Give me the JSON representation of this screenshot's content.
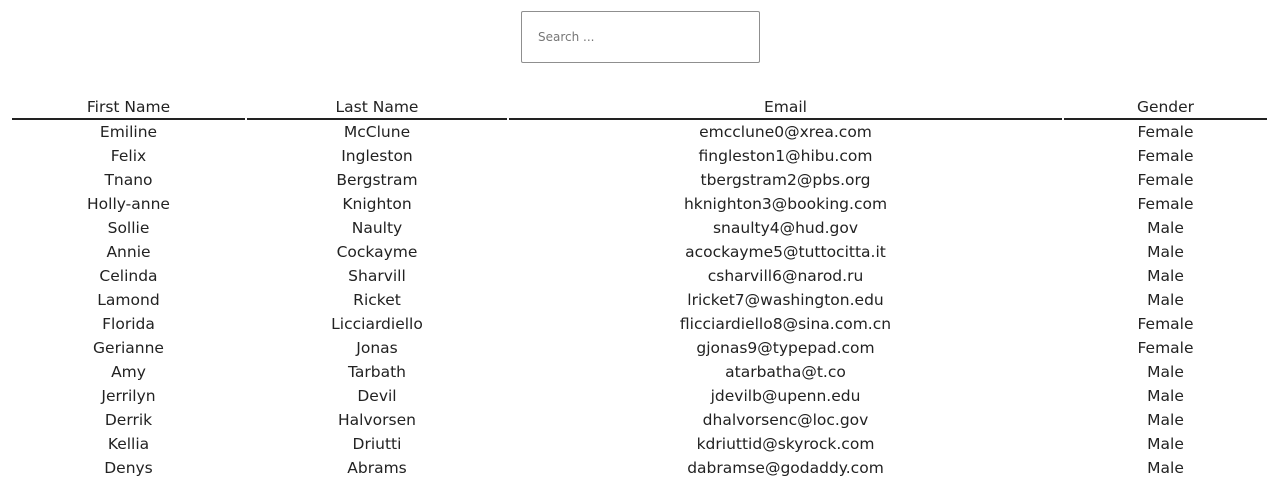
{
  "search": {
    "placeholder": "Search ..."
  },
  "table": {
    "headers": [
      "First Name",
      "Last Name",
      "Email",
      "Gender"
    ],
    "rows": [
      [
        "Emiline",
        "McClune",
        "emcclune0@xrea.com",
        "Female"
      ],
      [
        "Felix",
        "Ingleston",
        "fingleston1@hibu.com",
        "Female"
      ],
      [
        "Tnano",
        "Bergstram",
        "tbergstram2@pbs.org",
        "Female"
      ],
      [
        "Holly-anne",
        "Knighton",
        "hknighton3@booking.com",
        "Female"
      ],
      [
        "Sollie",
        "Naulty",
        "snaulty4@hud.gov",
        "Male"
      ],
      [
        "Annie",
        "Cockayme",
        "acockayme5@tuttocitta.it",
        "Male"
      ],
      [
        "Celinda",
        "Sharvill",
        "csharvill6@narod.ru",
        "Male"
      ],
      [
        "Lamond",
        "Ricket",
        "lricket7@washington.edu",
        "Male"
      ],
      [
        "Florida",
        "Licciardiello",
        "flicciardiello8@sina.com.cn",
        "Female"
      ],
      [
        "Gerianne",
        "Jonas",
        "gjonas9@typepad.com",
        "Female"
      ],
      [
        "Amy",
        "Tarbath",
        "atarbatha@t.co",
        "Male"
      ],
      [
        "Jerrilyn",
        "Devil",
        "jdevilb@upenn.edu",
        "Male"
      ],
      [
        "Derrik",
        "Halvorsen",
        "dhalvorsenc@loc.gov",
        "Male"
      ],
      [
        "Kellia",
        "Driutti",
        "kdriuttid@skyrock.com",
        "Male"
      ],
      [
        "Denys",
        "Abrams",
        "dabramse@godaddy.com",
        "Male"
      ]
    ]
  }
}
